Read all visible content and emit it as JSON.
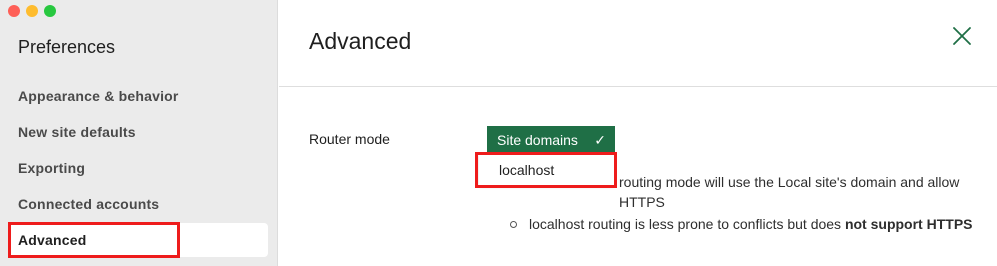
{
  "sidebar": {
    "title": "Preferences",
    "items": [
      {
        "label": "Appearance & behavior"
      },
      {
        "label": "New site defaults"
      },
      {
        "label": "Exporting"
      },
      {
        "label": "Connected accounts"
      },
      {
        "label": "Advanced",
        "active": true
      }
    ]
  },
  "main": {
    "title": "Advanced",
    "router_mode": {
      "label": "Router mode",
      "selected": "Site domains",
      "option": "localhost"
    },
    "notes": {
      "item1_visible": "routing mode will use the Local site's domain and allow HTTPS",
      "item2_prefix": "localhost routing is less prone to conflicts but does ",
      "item2_bold": "not support HTTPS"
    }
  },
  "colors": {
    "accent": "#1f6f46",
    "sidebar_bg": "#ebebeb",
    "highlight": "#ee1c1c"
  },
  "icons": {
    "close": "close-icon",
    "check": "check-icon"
  }
}
